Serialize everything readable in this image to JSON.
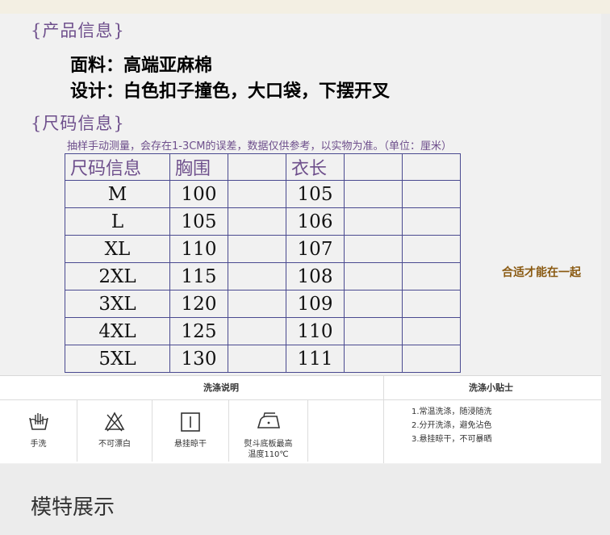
{
  "product_info": {
    "header": "{产品信息}",
    "fabric": "面料：高端亚麻棉",
    "design": "设计：白色扣子撞色，大口袋，下摆开叉"
  },
  "size_info": {
    "header": "{尺码信息}",
    "note": "抽样手动测量，会存在1-3CM的误差，数据仅供参考，以实物为准。（单位：厘米）",
    "columns": [
      "尺码信息",
      "胸围",
      "",
      "衣长",
      "",
      ""
    ],
    "rows": [
      [
        "M",
        "100",
        "",
        "105",
        "",
        ""
      ],
      [
        "L",
        "105",
        "",
        "106",
        "",
        ""
      ],
      [
        "XL",
        "110",
        "",
        "107",
        "",
        ""
      ],
      [
        "2XL",
        "115",
        "",
        "108",
        "",
        ""
      ],
      [
        "3XL",
        "120",
        "",
        "109",
        "",
        ""
      ],
      [
        "4XL",
        "125",
        "",
        "110",
        "",
        ""
      ],
      [
        "5XL",
        "130",
        "",
        "111",
        "",
        ""
      ]
    ],
    "fit_note": "合适才能在一起"
  },
  "washing": {
    "title": "洗涤说明",
    "tips_title": "洗涤小贴士",
    "items": [
      {
        "label": "手洗",
        "icon": "hand-wash-icon"
      },
      {
        "label": "不可漂白",
        "icon": "no-bleach-icon"
      },
      {
        "label": "悬挂晾干",
        "icon": "hang-dry-icon"
      },
      {
        "label": "熨斗底板最高温度110℃",
        "label_line1": "熨斗底板最高",
        "label_line2": "温度110℃",
        "icon": "iron-icon"
      }
    ],
    "tips": [
      "1.常温洗涤，随浸随洗",
      "2.分开洗涤，避免沾色",
      "3.悬挂晾干，不可暴晒"
    ]
  },
  "model_section": {
    "header": "模特展示"
  }
}
